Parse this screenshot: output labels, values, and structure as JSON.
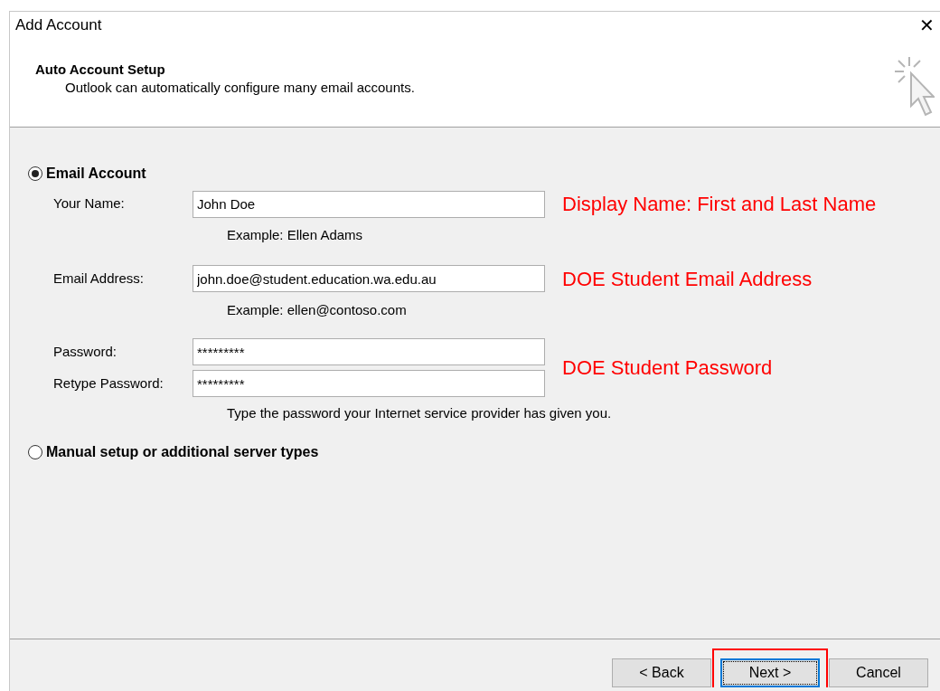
{
  "window": {
    "title": "Add Account",
    "close": "✕"
  },
  "header": {
    "title": "Auto Account Setup",
    "subtitle": "Outlook can automatically configure many email accounts."
  },
  "options": [
    {
      "label": "Email Account",
      "selected": true,
      "groups": [
        {
          "fields": [
            {
              "label": "Your Name:",
              "value": "John Doe"
            }
          ],
          "hint": "Example: Ellen Adams",
          "annotation": "Display Name: First and Last Name"
        },
        {
          "fields": [
            {
              "label": "Email Address:",
              "value": "john.doe@student.education.wa.edu.au"
            }
          ],
          "hint": "Example: ellen@contoso.com",
          "annotation": "DOE Student Email Address"
        },
        {
          "fields": [
            {
              "label": "Password:",
              "value": "*********"
            },
            {
              "label": "Retype Password:",
              "value": "*********"
            }
          ],
          "hint": "Type the password your Internet service provider has given you.",
          "annotation": "DOE Student Password"
        }
      ]
    },
    {
      "label": "Manual setup or additional server types",
      "selected": false
    }
  ],
  "buttons": [
    {
      "label": "< Back",
      "focused": false,
      "highlighted": false
    },
    {
      "label": "Next >",
      "focused": true,
      "highlighted": true
    },
    {
      "label": "Cancel",
      "focused": false,
      "highlighted": false
    }
  ]
}
